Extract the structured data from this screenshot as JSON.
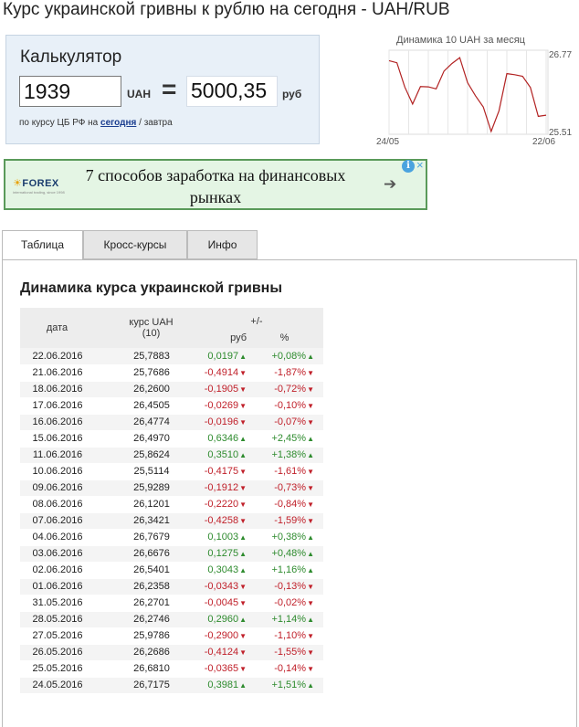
{
  "page": {
    "title": "Курс украинской гривны к рублю на сегодня - UAH/RUB"
  },
  "calculator": {
    "title": "Калькулятор",
    "input_value": "1939",
    "from_currency": "UAH",
    "equals": "=",
    "result": "5000,35",
    "to_currency": "руб",
    "note_prefix": "по курсу ЦБ РФ на",
    "note_today": "сегодня",
    "note_sep": "/",
    "note_tomorrow": "завтра"
  },
  "mini_chart": {
    "title": "Динамика 10 UAH за месяц",
    "y_max_label": "26.77",
    "y_min_label": "25.51",
    "x_start_label": "24/05",
    "x_end_label": "22/06",
    "line_color": "#b22222"
  },
  "ad": {
    "logo": "FOREX",
    "logo_sub": "international trading, since 1998",
    "text": "7 способов заработка на финансовых рынках",
    "arrow_icon": "arrow-right-icon",
    "info_icon": "i",
    "close_icon": "×"
  },
  "tabs": [
    {
      "label": "Таблица",
      "active": true
    },
    {
      "label": "Кросс-курсы",
      "active": false
    },
    {
      "label": "Инфо",
      "active": false
    }
  ],
  "table": {
    "section_title": "Динамика курса украинской гривны",
    "headers": {
      "date": "дата",
      "rate_line1": "курс UAH",
      "rate_line2": "(10)",
      "change": "+/-",
      "rub": "руб",
      "pct": "%"
    },
    "colors": {
      "up": "#2e8b2e",
      "down": "#c0202a"
    }
  },
  "chart_data": {
    "type": "table",
    "columns": [
      "дата",
      "курс UAH (10)",
      "руб",
      "%"
    ],
    "rows": [
      {
        "date": "22.06.2016",
        "rate": "25,7883",
        "rub": "0,0197",
        "pct": "+0,08%",
        "dir": "up"
      },
      {
        "date": "21.06.2016",
        "rate": "25,7686",
        "rub": "-0,4914",
        "pct": "-1,87%",
        "dir": "down"
      },
      {
        "date": "18.06.2016",
        "rate": "26,2600",
        "rub": "-0,1905",
        "pct": "-0,72%",
        "dir": "down"
      },
      {
        "date": "17.06.2016",
        "rate": "26,4505",
        "rub": "-0,0269",
        "pct": "-0,10%",
        "dir": "down"
      },
      {
        "date": "16.06.2016",
        "rate": "26,4774",
        "rub": "-0,0196",
        "pct": "-0,07%",
        "dir": "down"
      },
      {
        "date": "15.06.2016",
        "rate": "26,4970",
        "rub": "0,6346",
        "pct": "+2,45%",
        "dir": "up"
      },
      {
        "date": "11.06.2016",
        "rate": "25,8624",
        "rub": "0,3510",
        "pct": "+1,38%",
        "dir": "up"
      },
      {
        "date": "10.06.2016",
        "rate": "25,5114",
        "rub": "-0,4175",
        "pct": "-1,61%",
        "dir": "down"
      },
      {
        "date": "09.06.2016",
        "rate": "25,9289",
        "rub": "-0,1912",
        "pct": "-0,73%",
        "dir": "down"
      },
      {
        "date": "08.06.2016",
        "rate": "26,1201",
        "rub": "-0,2220",
        "pct": "-0,84%",
        "dir": "down"
      },
      {
        "date": "07.06.2016",
        "rate": "26,3421",
        "rub": "-0,4258",
        "pct": "-1,59%",
        "dir": "down"
      },
      {
        "date": "04.06.2016",
        "rate": "26,7679",
        "rub": "0,1003",
        "pct": "+0,38%",
        "dir": "up"
      },
      {
        "date": "03.06.2016",
        "rate": "26,6676",
        "rub": "0,1275",
        "pct": "+0,48%",
        "dir": "up"
      },
      {
        "date": "02.06.2016",
        "rate": "26,5401",
        "rub": "0,3043",
        "pct": "+1,16%",
        "dir": "up"
      },
      {
        "date": "01.06.2016",
        "rate": "26,2358",
        "rub": "-0,0343",
        "pct": "-0,13%",
        "dir": "down"
      },
      {
        "date": "31.05.2016",
        "rate": "26,2701",
        "rub": "-0,0045",
        "pct": "-0,02%",
        "dir": "down"
      },
      {
        "date": "28.05.2016",
        "rate": "26,2746",
        "rub": "0,2960",
        "pct": "+1,14%",
        "dir": "up"
      },
      {
        "date": "27.05.2016",
        "rate": "25,9786",
        "rub": "-0,2900",
        "pct": "-1,10%",
        "dir": "down"
      },
      {
        "date": "26.05.2016",
        "rate": "26,2686",
        "rub": "-0,4124",
        "pct": "-1,55%",
        "dir": "down"
      },
      {
        "date": "25.05.2016",
        "rate": "26,6810",
        "rub": "-0,0365",
        "pct": "-0,14%",
        "dir": "down"
      },
      {
        "date": "24.05.2016",
        "rate": "26,7175",
        "rub": "0,3981",
        "pct": "+1,51%",
        "dir": "up"
      }
    ]
  }
}
